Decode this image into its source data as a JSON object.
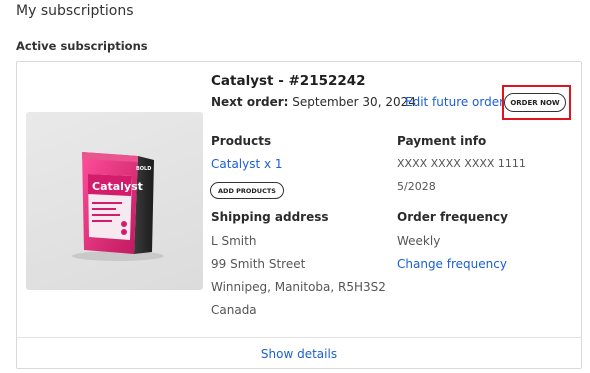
{
  "page": {
    "title": "My subscriptions",
    "section_title": "Active subscriptions"
  },
  "subscription": {
    "title": "Catalyst - #2152242",
    "next_order_label": "Next order:",
    "next_order_date": "September 30, 2024",
    "edit_link": "Edit future order",
    "order_now_label": "ORDER NOW",
    "image": {
      "brand_text": "BOLD",
      "product_name_on_pack": "Catalyst",
      "colors": {
        "pack_pink": "#e0267a",
        "pack_dark": "#2a2a2a"
      }
    },
    "products": {
      "heading": "Products",
      "item_link": "Catalyst x 1",
      "add_button": "ADD PRODUCTS"
    },
    "payment": {
      "heading": "Payment info",
      "card_number": "XXXX XXXX XXXX 1111",
      "expiry": "5/2028"
    },
    "shipping": {
      "heading": "Shipping address",
      "name": "L Smith",
      "street": "99 Smith Street",
      "city_line": "Winnipeg, Manitoba, R5H3S2",
      "country": "Canada"
    },
    "frequency": {
      "heading": "Order frequency",
      "value": "Weekly",
      "change_link": "Change frequency"
    },
    "show_details": "Show details"
  },
  "colors": {
    "link": "#1a5fd6",
    "highlight": "#e0141e",
    "border": "#d9d9d9"
  }
}
